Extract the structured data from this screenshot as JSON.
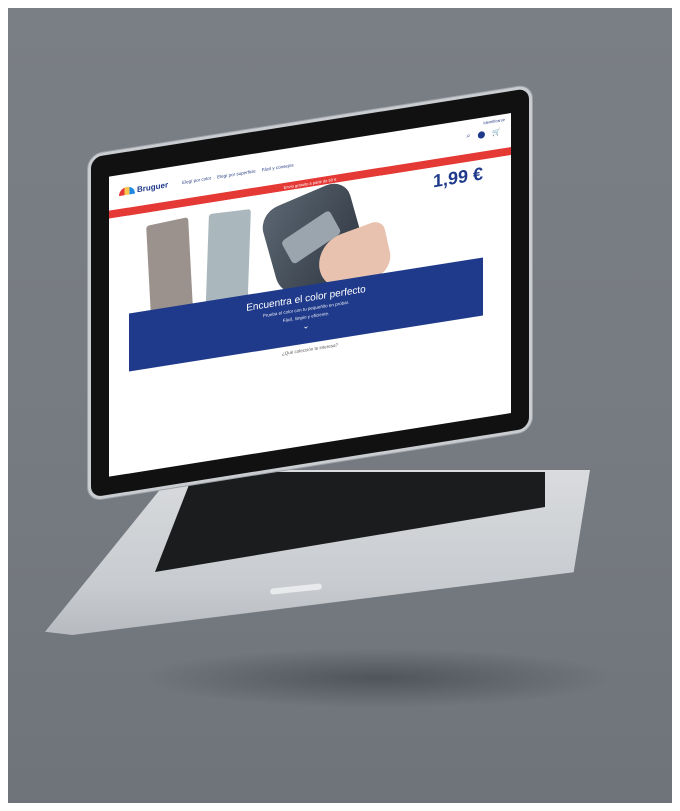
{
  "site": {
    "logo_text": "Bruguer",
    "nav": [
      "Elegí por color",
      "Elegí por superficie",
      "Fácil y consejos"
    ],
    "login_label": "Identificarse",
    "promo_text": "Envío gratuito a partir de 50 €",
    "price": "1,99 €",
    "hero_title": "Encuentra el color perfecto",
    "hero_sub_1": "Prueba el color con tu pequeñito en probar.",
    "hero_sub_2": "Fácil, limpio y eficiente.",
    "footer_question": "¿Qué colección te interesa?"
  },
  "icons": {
    "search": "search-icon",
    "location": "location-pin-icon",
    "cart": "cart-icon",
    "chevron": "chevron-down-icon"
  },
  "colors": {
    "brand_blue": "#1f3a8a",
    "promo_red": "#e53935",
    "swatch_taupe": "#9b928d",
    "swatch_grey_blue": "#aab8bd"
  }
}
